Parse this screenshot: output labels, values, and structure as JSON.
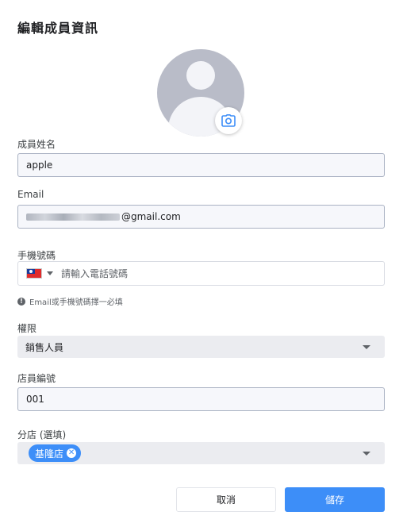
{
  "dialog": {
    "title": "編輯成員資訊"
  },
  "avatar": {
    "icon": "default-user-avatar",
    "camera_icon": "camera-icon"
  },
  "fields": {
    "name": {
      "label": "成員姓名",
      "value": "apple"
    },
    "email": {
      "label": "Email",
      "value_visible_suffix": "@gmail.com"
    },
    "phone": {
      "label": "手機號碼",
      "country_flag": "taiwan-flag-icon",
      "placeholder": "請輸入電話號碼"
    },
    "hint": "Email或手機號碼擇一必填",
    "role": {
      "label": "權限",
      "value": "銷售人員"
    },
    "store_number": {
      "label": "店員編號",
      "value": "001"
    },
    "branch": {
      "label": "分店 (選填)",
      "chips": [
        "基隆店"
      ]
    }
  },
  "actions": {
    "cancel": "取消",
    "save": "儲存"
  },
  "colors": {
    "primary": "#3d8ef8",
    "avatar_bg": "#b9bcc8"
  }
}
